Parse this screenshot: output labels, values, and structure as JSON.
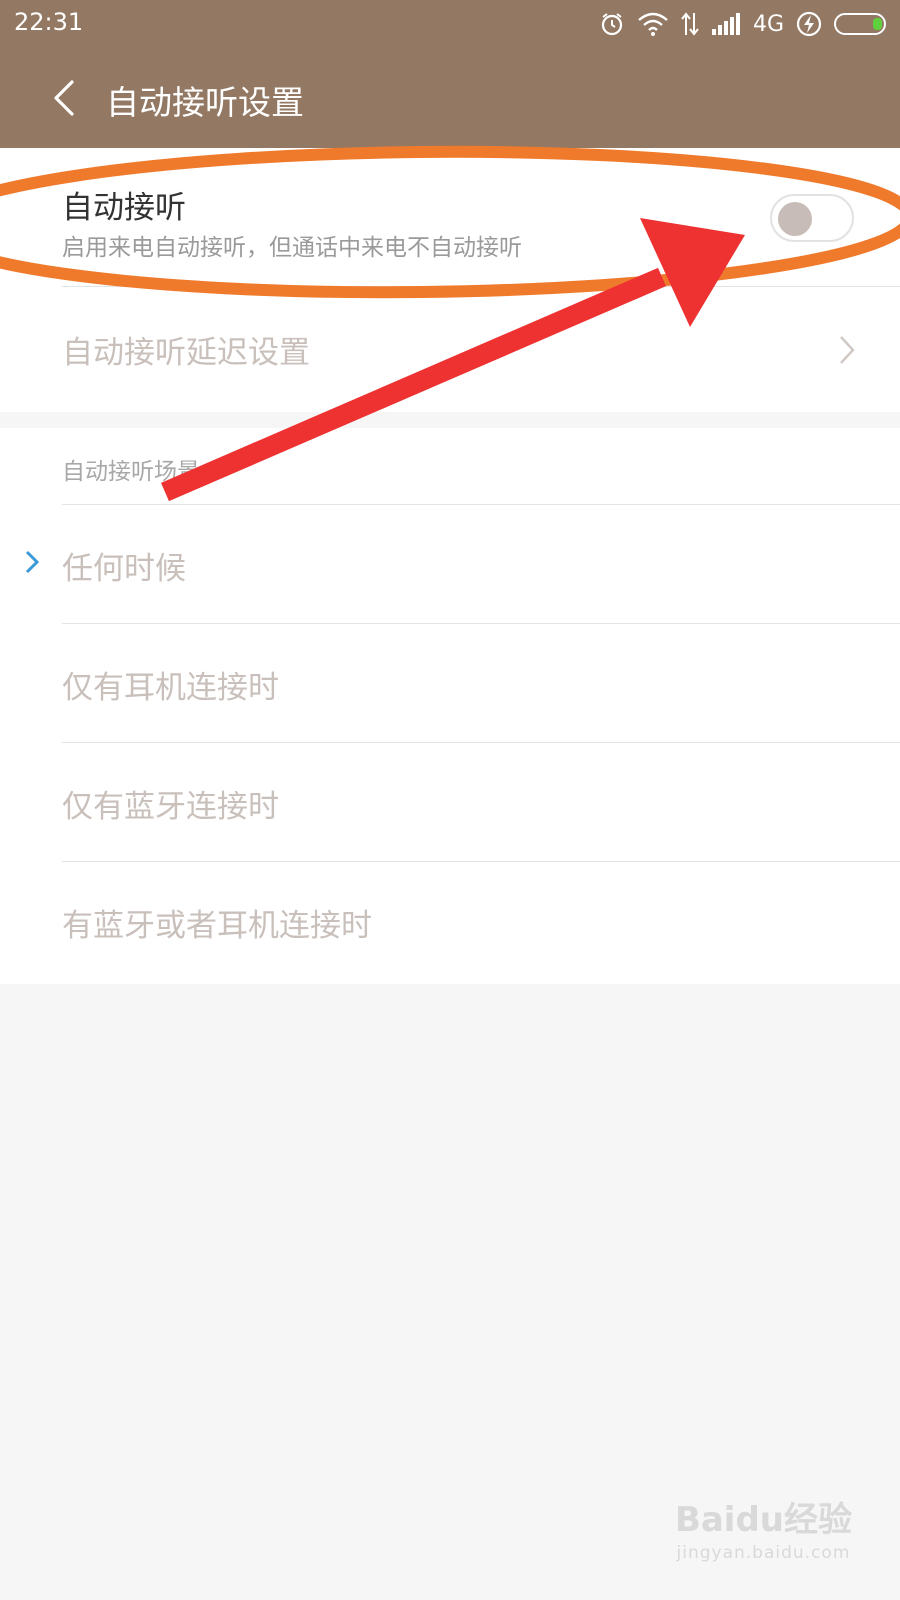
{
  "status_bar": {
    "time": "22:31",
    "network": "4G"
  },
  "header": {
    "title": "自动接听设置"
  },
  "auto_answer": {
    "title": "自动接听",
    "subtitle": "启用来电自动接听，但通话中来电不自动接听",
    "enabled": false
  },
  "delay_settings": {
    "label": "自动接听延迟设置"
  },
  "scenes": {
    "header": "自动接听场景",
    "options": [
      {
        "label": "任何时候",
        "selected": true
      },
      {
        "label": "仅有耳机连接时",
        "selected": false
      },
      {
        "label": "仅有蓝牙连接时",
        "selected": false
      },
      {
        "label": "有蓝牙或者耳机连接时",
        "selected": false
      }
    ]
  },
  "watermark": {
    "logo": "Baidu经验",
    "url": "jingyan.baidu.com"
  },
  "colors": {
    "header_bg": "#937863",
    "accent_check": "#3b9bd8",
    "annotation_ellipse": "#f07a2c",
    "annotation_arrow": "#ee3232"
  }
}
